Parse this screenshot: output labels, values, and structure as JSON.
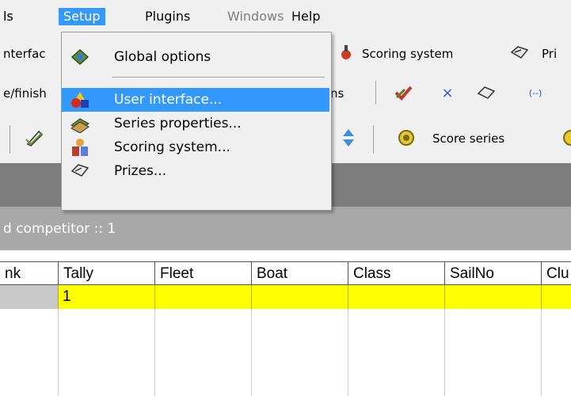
{
  "menubar": {
    "items": [
      {
        "label": "ls"
      },
      {
        "label": "Setup"
      },
      {
        "label": "Plugins"
      },
      {
        "label": "Windows"
      },
      {
        "label": "Help"
      }
    ]
  },
  "toolbar1": {
    "left_partial": "nterfac",
    "scoring_label": "Scoring system",
    "prizes_partial": "Pri"
  },
  "toolbar2": {
    "left_partial": "e/finish",
    "ins_partial": "ns"
  },
  "toolbar3": {
    "score_series_label": "Score series"
  },
  "dropdown": {
    "items": [
      {
        "label": "Global options"
      },
      {
        "label": "User interface..."
      },
      {
        "label": "Series properties..."
      },
      {
        "label": "Scoring system..."
      },
      {
        "label": "Prizes..."
      }
    ]
  },
  "panel": {
    "title": "d competitor :: 1"
  },
  "grid": {
    "columns": [
      "nk",
      "Tally",
      "Fleet",
      "Boat",
      "Class",
      "SailNo",
      "Clu"
    ],
    "rows": [
      [
        "",
        "1",
        "",
        "",
        "",
        "",
        ""
      ]
    ]
  },
  "colors": {
    "highlight": "#3399ff",
    "row_yellow": "#ffff00",
    "menubar_bg": "#f0f0f0"
  }
}
